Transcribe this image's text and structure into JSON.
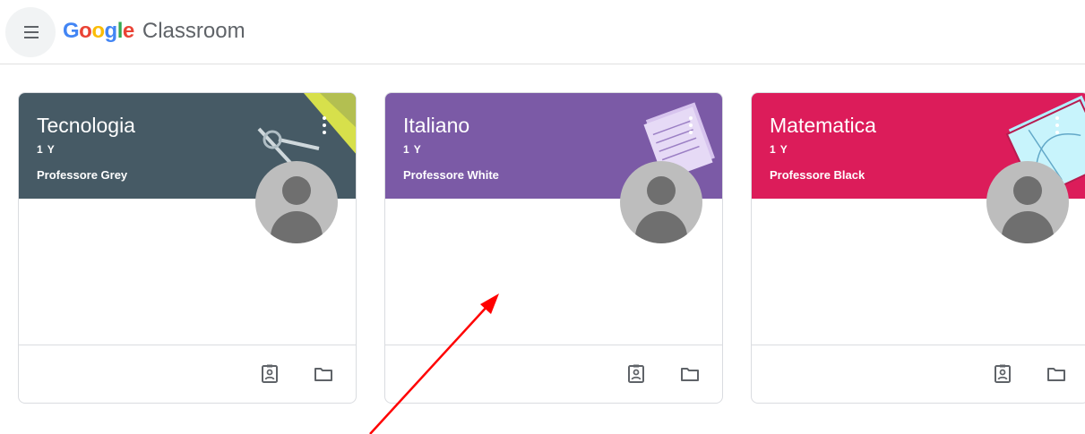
{
  "header": {
    "logo_google": [
      "G",
      "o",
      "o",
      "g",
      "l",
      "e"
    ],
    "logo_colors": [
      "#4285F4",
      "#EA4335",
      "#FBBC05",
      "#4285F4",
      "#34A853",
      "#EA4335"
    ],
    "product_name": "Classroom"
  },
  "classes": [
    {
      "title": "Tecnologia",
      "section": "1 Y",
      "teacher": "Professore Grey",
      "color": "#465a65"
    },
    {
      "title": "Italiano",
      "section": "1 Y",
      "teacher": "Professore White",
      "color": "#7b5aa6"
    },
    {
      "title": "Matematica",
      "section": "1 Y",
      "teacher": "Professore Black",
      "color": "#dc1c5a"
    }
  ],
  "icons": {
    "menu": "hamburger-menu-icon",
    "options": "more-vert-icon",
    "avatar": "teacher-avatar-icon",
    "work": "assignment-ind-icon",
    "folder": "folder-icon"
  },
  "annotation": {
    "arrow_color": "#ff0000"
  }
}
